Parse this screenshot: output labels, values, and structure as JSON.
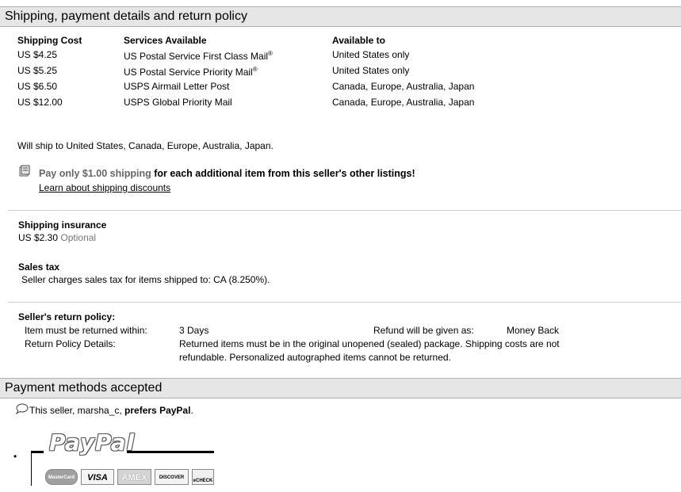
{
  "shipping_section": {
    "title": "Shipping, payment details and return policy",
    "headers": [
      "Shipping Cost",
      "Services Available",
      "Available to"
    ],
    "rows": [
      {
        "cost": "US $4.25",
        "service": "US Postal Service First Class Mail",
        "reg": "®",
        "to": "United States only"
      },
      {
        "cost": "US $5.25",
        "service": "US Postal Service Priority Mail",
        "reg": "®",
        "to": "United States only"
      },
      {
        "cost": "US $6.50",
        "service": "USPS Airmail Letter Post",
        "reg": "",
        "to": "Canada, Europe, Australia, Japan"
      },
      {
        "cost": "US $12.00",
        "service": "USPS Global Priority Mail",
        "reg": "",
        "to": "Canada, Europe, Australia, Japan"
      }
    ],
    "will_ship": "Will ship to United States, Canada, Europe, Australia, Japan.",
    "discount_prefix": "Pay only $1.00 shipping",
    "discount_suffix": " for each additional item from this seller's other listings!",
    "discount_link": "Learn about shipping discounts"
  },
  "insurance": {
    "title": "Shipping insurance",
    "amount": "US $2.30",
    "optional": "Optional"
  },
  "sales_tax": {
    "title": "Sales tax",
    "text": "Seller charges sales tax for items shipped to: CA (8.250%)."
  },
  "return_policy": {
    "title": "Seller's return policy:",
    "within_label": "Item must be returned within:",
    "within_value": "3 Days",
    "refund_label": "Refund will be given as:",
    "refund_value": "Money Back",
    "details_label": "Return Policy Details:",
    "details_line1": "Returned items must be in the original unopened (sealed) package. Shipping costs are not",
    "details_line2": "refundable. Personalized autographed items cannot be returned."
  },
  "payment": {
    "title": "Payment methods accepted",
    "prefers_prefix": "This seller, marsha_c, ",
    "prefers_bold": "prefers PayPal",
    "prefers_suffix": ".",
    "paypal_logo": "PayPal",
    "bullet": "•",
    "cards": [
      "MasterCard",
      "VISA",
      "AMEX",
      "DISCOVER",
      "eCHECK"
    ]
  }
}
